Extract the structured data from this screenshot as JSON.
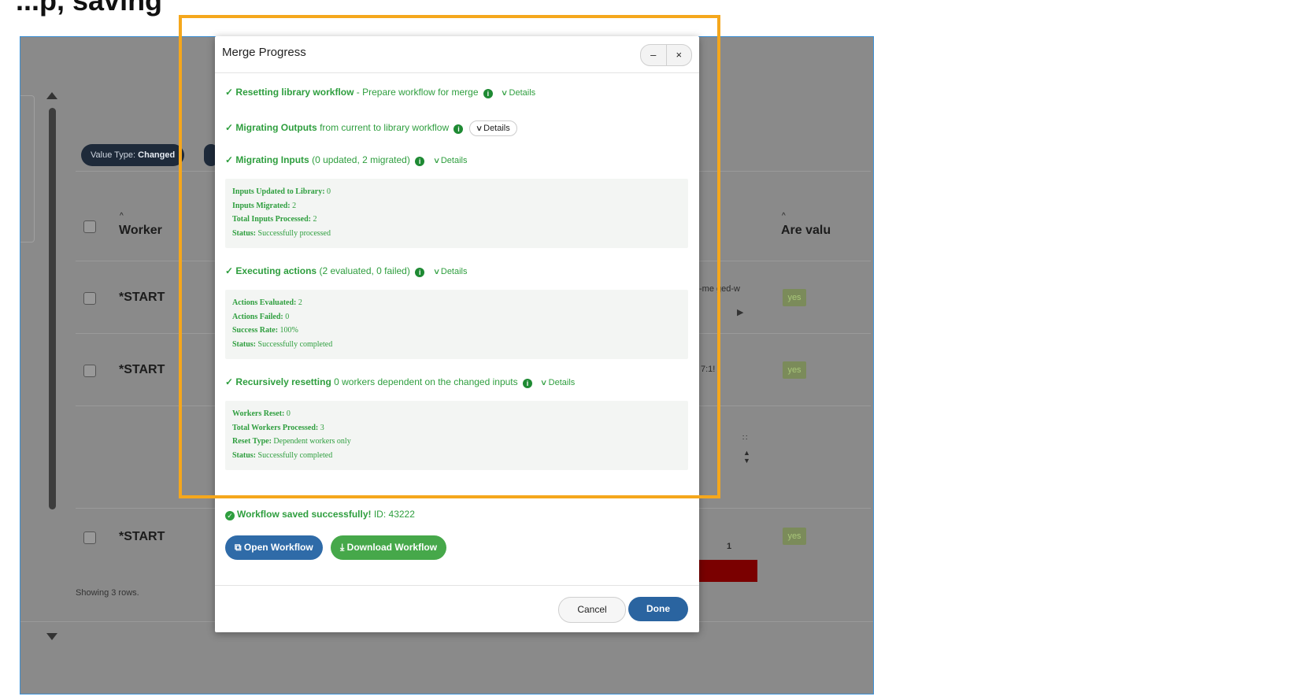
{
  "page": {
    "step_title": "...p, saving"
  },
  "background": {
    "chips": [
      {
        "label": "Value Type:",
        "value": "Changed"
      }
    ],
    "columns": {
      "worker_sort": "^",
      "worker": "Worker",
      "values_sort": "^",
      "values": "Are valu"
    },
    "rows": [
      {
        "worker": "*START",
        "value": "yes"
      },
      {
        "worker": "*START",
        "value": "yes"
      },
      {
        "worker": "*START",
        "value": "yes"
      }
    ],
    "fragments": {
      "merged": "-me ged-w",
      "time": "7:1!",
      "one": "1"
    },
    "showing": "Showing 3 rows."
  },
  "modal": {
    "title": "Merge Progress",
    "minimize": "–",
    "close": "×",
    "details_label": "Details",
    "steps": [
      {
        "bold": "Resetting library workflow",
        "rest": " - Prepare workflow for merge"
      },
      {
        "bold": "Migrating Outputs",
        "rest": " from current to library workflow"
      },
      {
        "bold": "Migrating Inputs",
        "rest": " (0 updated, 2 migrated)"
      },
      {
        "bold": "Executing actions",
        "rest": " (2 evaluated, 0 failed)"
      },
      {
        "bold": "Recursively resetting",
        "rest": " 0 workers dependent on the changed inputs"
      }
    ],
    "inputs_details": [
      {
        "k": "Inputs Updated to Library:",
        "v": " 0"
      },
      {
        "k": "Inputs Migrated:",
        "v": " 2"
      },
      {
        "k": "Total Inputs Processed:",
        "v": " 2"
      },
      {
        "k": "Status:",
        "v": " Successfully processed"
      }
    ],
    "actions_details": [
      {
        "k": "Actions Evaluated:",
        "v": " 2"
      },
      {
        "k": "Actions Failed:",
        "v": " 0"
      },
      {
        "k": "Success Rate:",
        "v": " 100%"
      },
      {
        "k": "Status:",
        "v": " Successfully completed"
      }
    ],
    "reset_details": [
      {
        "k": "Workers Reset:",
        "v": " 0"
      },
      {
        "k": "Total Workers Processed:",
        "v": " 3"
      },
      {
        "k": "Reset Type:",
        "v": " Dependent workers only"
      },
      {
        "k": "Status:",
        "v": " Successfully completed"
      }
    ],
    "saved": {
      "bold": "Workflow saved successfully!",
      "rest": " ID: 43222"
    },
    "open_workflow": "Open Workflow",
    "download_workflow": "Download Workflow",
    "cancel": "Cancel",
    "done": "Done"
  },
  "colors": {
    "accent_green": "#2e9e3e",
    "primary_blue": "#2a64a0",
    "highlight": "#f5a71c"
  }
}
